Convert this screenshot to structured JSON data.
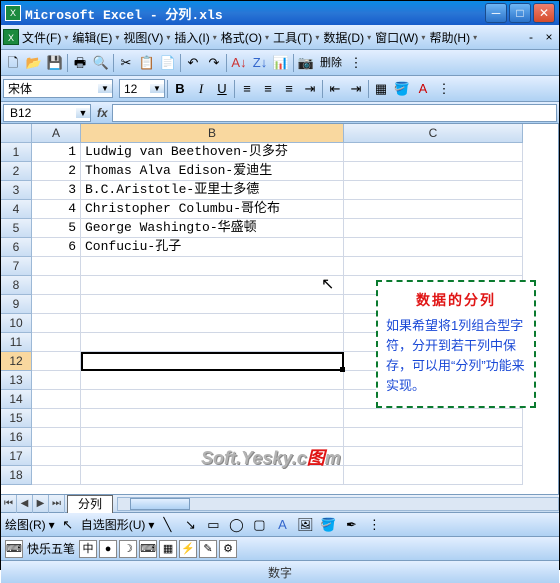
{
  "title": "Microsoft Excel - 分列.xls",
  "menu": {
    "file": "文件(F)",
    "edit": "编辑(E)",
    "view": "视图(V)",
    "insert": "插入(I)",
    "format": "格式(O)",
    "tools": "工具(T)",
    "data": "数据(D)",
    "window": "窗口(W)",
    "help": "帮助(H)"
  },
  "font": {
    "name": "宋体",
    "size": "12"
  },
  "namebox": "B12",
  "cols": [
    "A",
    "B",
    "C"
  ],
  "rows": [
    {
      "n": 1,
      "a": "1",
      "b": "Ludwig van Beethoven-贝多芬"
    },
    {
      "n": 2,
      "a": "2",
      "b": "Thomas Alva Edison-爱迪生"
    },
    {
      "n": 3,
      "a": "3",
      "b": "B.C.Aristotle-亚里士多德"
    },
    {
      "n": 4,
      "a": "4",
      "b": "Christopher Columbu-哥伦布"
    },
    {
      "n": 5,
      "a": "5",
      "b": "George Washingto-华盛顿"
    },
    {
      "n": 6,
      "a": "6",
      "b": "Confuciu-孔子"
    },
    {
      "n": 7
    },
    {
      "n": 8
    },
    {
      "n": 9
    },
    {
      "n": 10
    },
    {
      "n": 11
    },
    {
      "n": 12
    },
    {
      "n": 13
    },
    {
      "n": 14
    },
    {
      "n": 15
    },
    {
      "n": 16
    },
    {
      "n": 17
    },
    {
      "n": 18
    }
  ],
  "note": {
    "title": "数据的分列",
    "body": "如果希望将1列组合型字符，分开到若干列中保存，可以用“分列”功能来实现。"
  },
  "tab": "分列",
  "watermark": {
    "a": "Soft.Yesky.c",
    "b": "图",
    "c": "m"
  },
  "draw": {
    "label": "绘图(R)",
    "autoshape": "自选图形(U)"
  },
  "ime": "快乐五笔",
  "status_num": "数字",
  "toolbar_delete": "删除"
}
